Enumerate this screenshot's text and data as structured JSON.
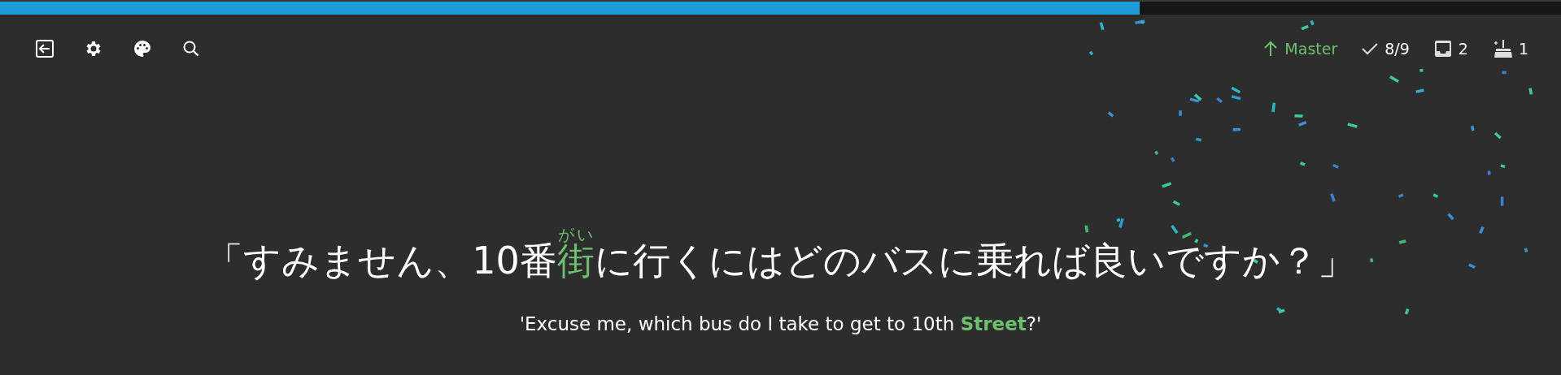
{
  "progress": {
    "level": 0.73
  },
  "toolbar": [
    {
      "kind": "exit"
    },
    {
      "kind": "settings"
    },
    {
      "kind": "palette"
    },
    {
      "kind": "search"
    }
  ],
  "status": [
    {
      "kind": "branch",
      "label": "Master"
    },
    {
      "kind": "check",
      "label": "8/9"
    },
    {
      "kind": "inbox",
      "label": "2"
    },
    {
      "kind": "broom",
      "label": "1"
    }
  ],
  "sentence": {
    "before": "「すみません、10番",
    "highlight": {
      "text": "街",
      "reading": "がい"
    },
    "after": "に行くにはどのバスに乗れば良いですか？」"
  },
  "translation": "'Excuse me, which bus do I take to get to 10th **Street**?'"
}
